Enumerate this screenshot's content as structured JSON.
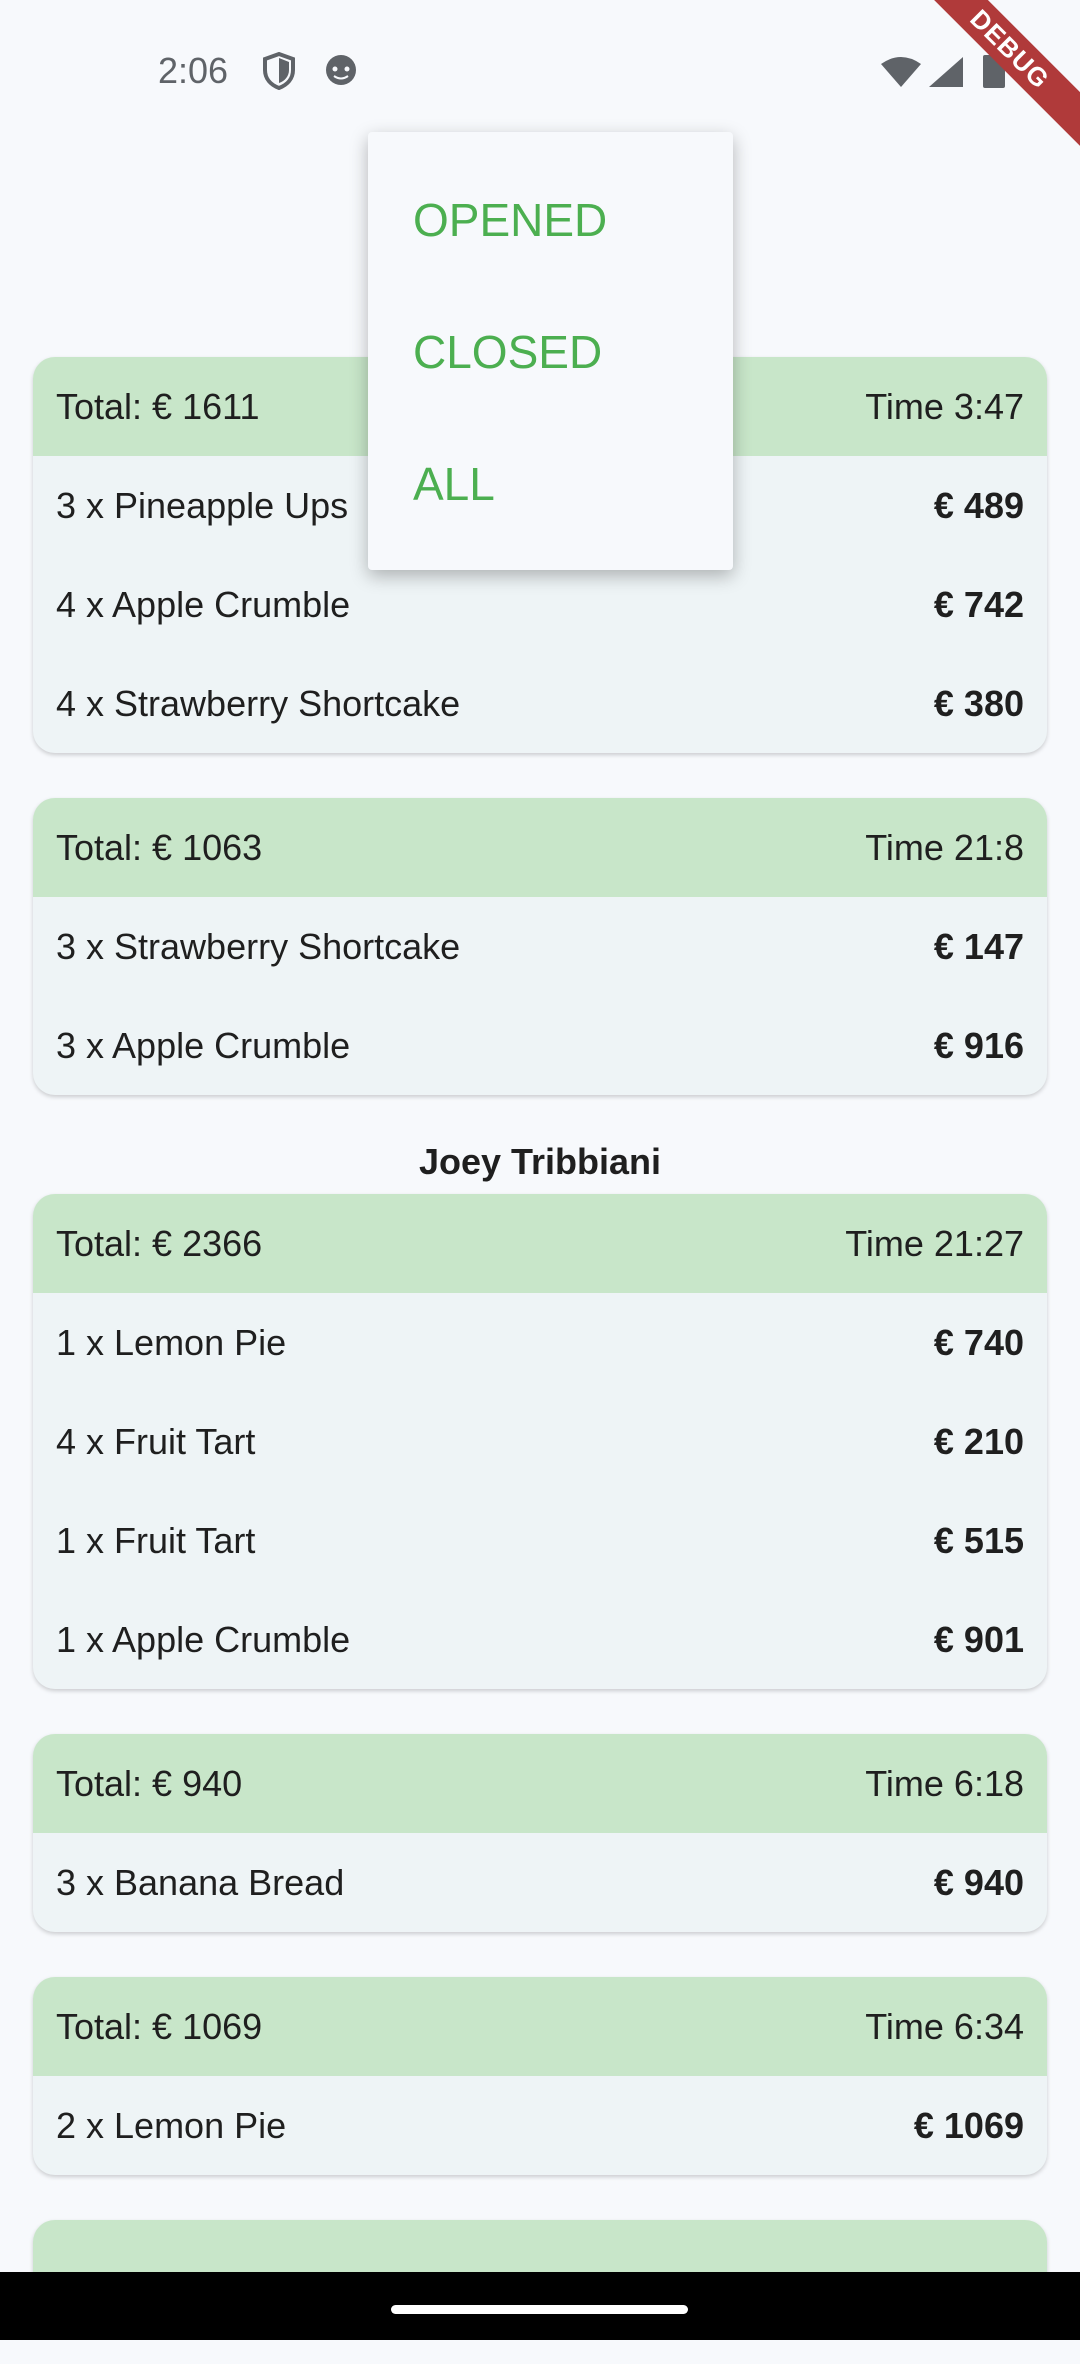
{
  "status_bar": {
    "time": "2:06"
  },
  "debug_ribbon": "DEBUG",
  "popup_menu": {
    "items": [
      "OPENED",
      "CLOSED",
      "ALL"
    ],
    "accent_color": "#4caf50"
  },
  "orders": [
    {
      "total": "Total: € 1611",
      "time": "Time 3:47",
      "items": [
        {
          "name": "3 x Pineapple Ups",
          "price": "€ 489"
        },
        {
          "name": "4 x Apple Crumble",
          "price": "€ 742"
        },
        {
          "name": "4 x Strawberry Shortcake",
          "price": "€ 380"
        }
      ]
    },
    {
      "total": "Total: € 1063",
      "time": "Time 21:8",
      "items": [
        {
          "name": "3 x Strawberry Shortcake",
          "price": "€ 147"
        },
        {
          "name": "3 x Apple Crumble",
          "price": "€ 916"
        }
      ]
    }
  ],
  "customer2": {
    "name": "Joey Tribbiani",
    "orders": [
      {
        "total": "Total: € 2366",
        "time": "Time 21:27",
        "items": [
          {
            "name": "1 x Lemon Pie",
            "price": "€ 740"
          },
          {
            "name": "4 x Fruit Tart",
            "price": "€ 210"
          },
          {
            "name": "1 x Fruit Tart",
            "price": "€ 515"
          },
          {
            "name": "1 x Apple Crumble",
            "price": "€ 901"
          }
        ]
      },
      {
        "total": "Total: € 940",
        "time": "Time 6:18",
        "items": [
          {
            "name": "3 x Banana Bread",
            "price": "€ 940"
          }
        ]
      },
      {
        "total": "Total: € 1069",
        "time": "Time 6:34",
        "items": [
          {
            "name": "2 x Lemon Pie",
            "price": "€ 1069"
          }
        ]
      }
    ]
  },
  "colors": {
    "header_green": "#c8e6c9",
    "card_bg": "#eef4f6",
    "page_bg": "#f7f9fc"
  }
}
